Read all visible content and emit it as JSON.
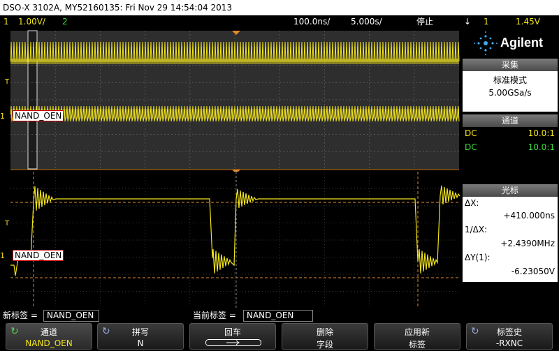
{
  "title": "DSO-X 3102A, MY52160135: Fri Nov 29 14:54:04 2013",
  "status": {
    "ch1_num": "1",
    "ch1_scale": "1.00V/",
    "ch2_num": "2",
    "time_scale": "100.0ns/",
    "time_delay": "5.000s/",
    "run_state": "停止",
    "trig_icon": "↓",
    "trig_ch": "1",
    "trig_level": "1.45V"
  },
  "traces": {
    "upper_label": "NAND_OEN",
    "lower_label": "NAND_OEN",
    "marker_t": "T",
    "marker_1": "1"
  },
  "side": {
    "logo": "Agilent",
    "acq_head": "采集",
    "acq_mode": "标准模式",
    "acq_rate": "5.00GSa/s",
    "chan_head": "通道",
    "chan_rows": [
      {
        "coupling": "DC",
        "probe": "10.0:1",
        "color": "#f2e51c"
      },
      {
        "coupling": "DC",
        "probe": "10.0:1",
        "color": "#3adc3a"
      }
    ],
    "cursor_head": "光标",
    "dx_label": "ΔX:",
    "dx_value": "+410.000ns",
    "inv_dx_label": "1/ΔX:",
    "inv_dx_value": "+2.4390MHz",
    "dy_label": "ΔY(1):",
    "dy_value": "-6.23050V"
  },
  "bottom": {
    "new_label_caption": "新标签 =",
    "new_label_value": "NAND_OEN",
    "cur_label_caption": "当前标签 =",
    "cur_label_value": "NAND_OEN"
  },
  "softkeys": [
    {
      "line1": "通道",
      "line2": "NAND_OEN",
      "icon": "rotate-knob-icon"
    },
    {
      "line1": "拼写",
      "line2": "N",
      "icon": "rotate-knob-icon"
    },
    {
      "line1": "回车",
      "line2": "",
      "icon": "arrow-right-icon"
    },
    {
      "line1": "删除",
      "line2": "字段",
      "icon": ""
    },
    {
      "line1": "应用新",
      "line2": "标签",
      "icon": ""
    },
    {
      "line1": "标签史",
      "line2": "-RXNC",
      "icon": "rotate-knob-icon"
    }
  ],
  "colors": {
    "ch1": "#f2e51c",
    "ch2": "#3adc3a",
    "cursor": "#e58a2c"
  }
}
